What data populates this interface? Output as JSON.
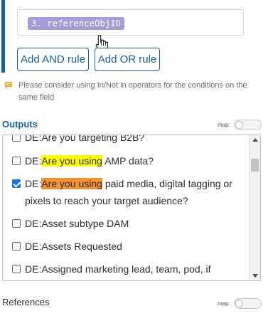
{
  "rule": {
    "token_text": "3. referenceObjID",
    "and_button": "Add AND rule",
    "or_button": "Add OR rule",
    "accent_color": "#1261a0",
    "token_color": "#a89bdc"
  },
  "note": {
    "icon": "comment-icon",
    "text": "Please consider using In/Not in operators for the conditions on the same field"
  },
  "outputs": {
    "title": "Outputs",
    "map_label": "map:",
    "map_enabled": false,
    "options": [
      {
        "pre": "DE:Are you targeting B2B?",
        "hl": "",
        "post": "",
        "checked": false
      },
      {
        "pre": "DE:",
        "hl": "Are you using",
        "post": " AMP data?",
        "checked": false,
        "hl_color": "#ffff00"
      },
      {
        "pre": "DE:",
        "hl": "Are you using",
        "post": " paid media, digital tagging or pixels to reach your target audience?",
        "checked": true,
        "hl_color": "#f59431"
      },
      {
        "pre": "DE:Asset subtype DAM",
        "hl": "",
        "post": "",
        "checked": false
      },
      {
        "pre": "DE:Assets Requested",
        "hl": "",
        "post": "",
        "checked": false
      },
      {
        "pre": "DE:Assigned marketing lead, team, pod, if",
        "hl": "",
        "post": "",
        "checked": false
      }
    ]
  },
  "references": {
    "title": "References",
    "map_label": "map:",
    "map_enabled": false
  }
}
